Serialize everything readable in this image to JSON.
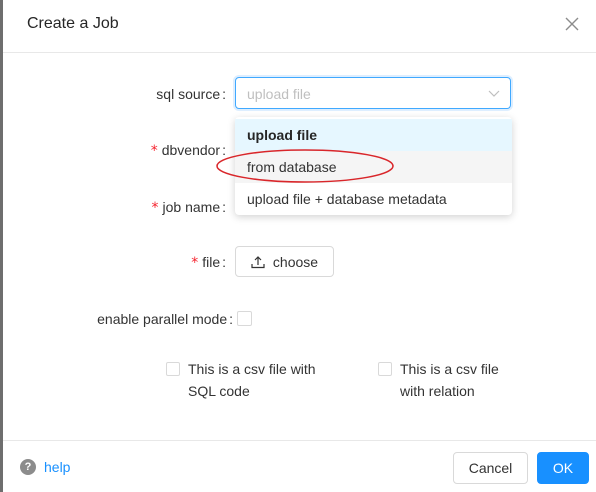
{
  "dialog": {
    "title": "Create a Job"
  },
  "form": {
    "sql_source": {
      "label": "sql source",
      "colon": ":",
      "value": "upload file",
      "options": [
        "upload file",
        "from database",
        "upload file + database metadata"
      ]
    },
    "dbvendor": {
      "required": "*",
      "label": "dbvendor",
      "colon": ":"
    },
    "job_name": {
      "required": "*",
      "label": "job name",
      "colon": ":"
    },
    "file": {
      "required": "*",
      "label": "file",
      "colon": ":",
      "button_label": "choose"
    },
    "parallel": {
      "label": "enable parallel mode",
      "colon": ":"
    },
    "checkboxes": [
      {
        "line1": "This is a csv file with",
        "line2": "SQL code"
      },
      {
        "line1": "This is a csv file",
        "line2": "with relation"
      }
    ]
  },
  "footer": {
    "help_icon_glyph": "?",
    "help_label": "help",
    "cancel_label": "Cancel",
    "ok_label": "OK"
  },
  "colors": {
    "primary": "#1890ff",
    "required": "#f5222d",
    "annotation": "#d9262a"
  },
  "icons": [
    "close-icon",
    "chevron-down-icon",
    "upload-icon",
    "question-circle-icon"
  ]
}
